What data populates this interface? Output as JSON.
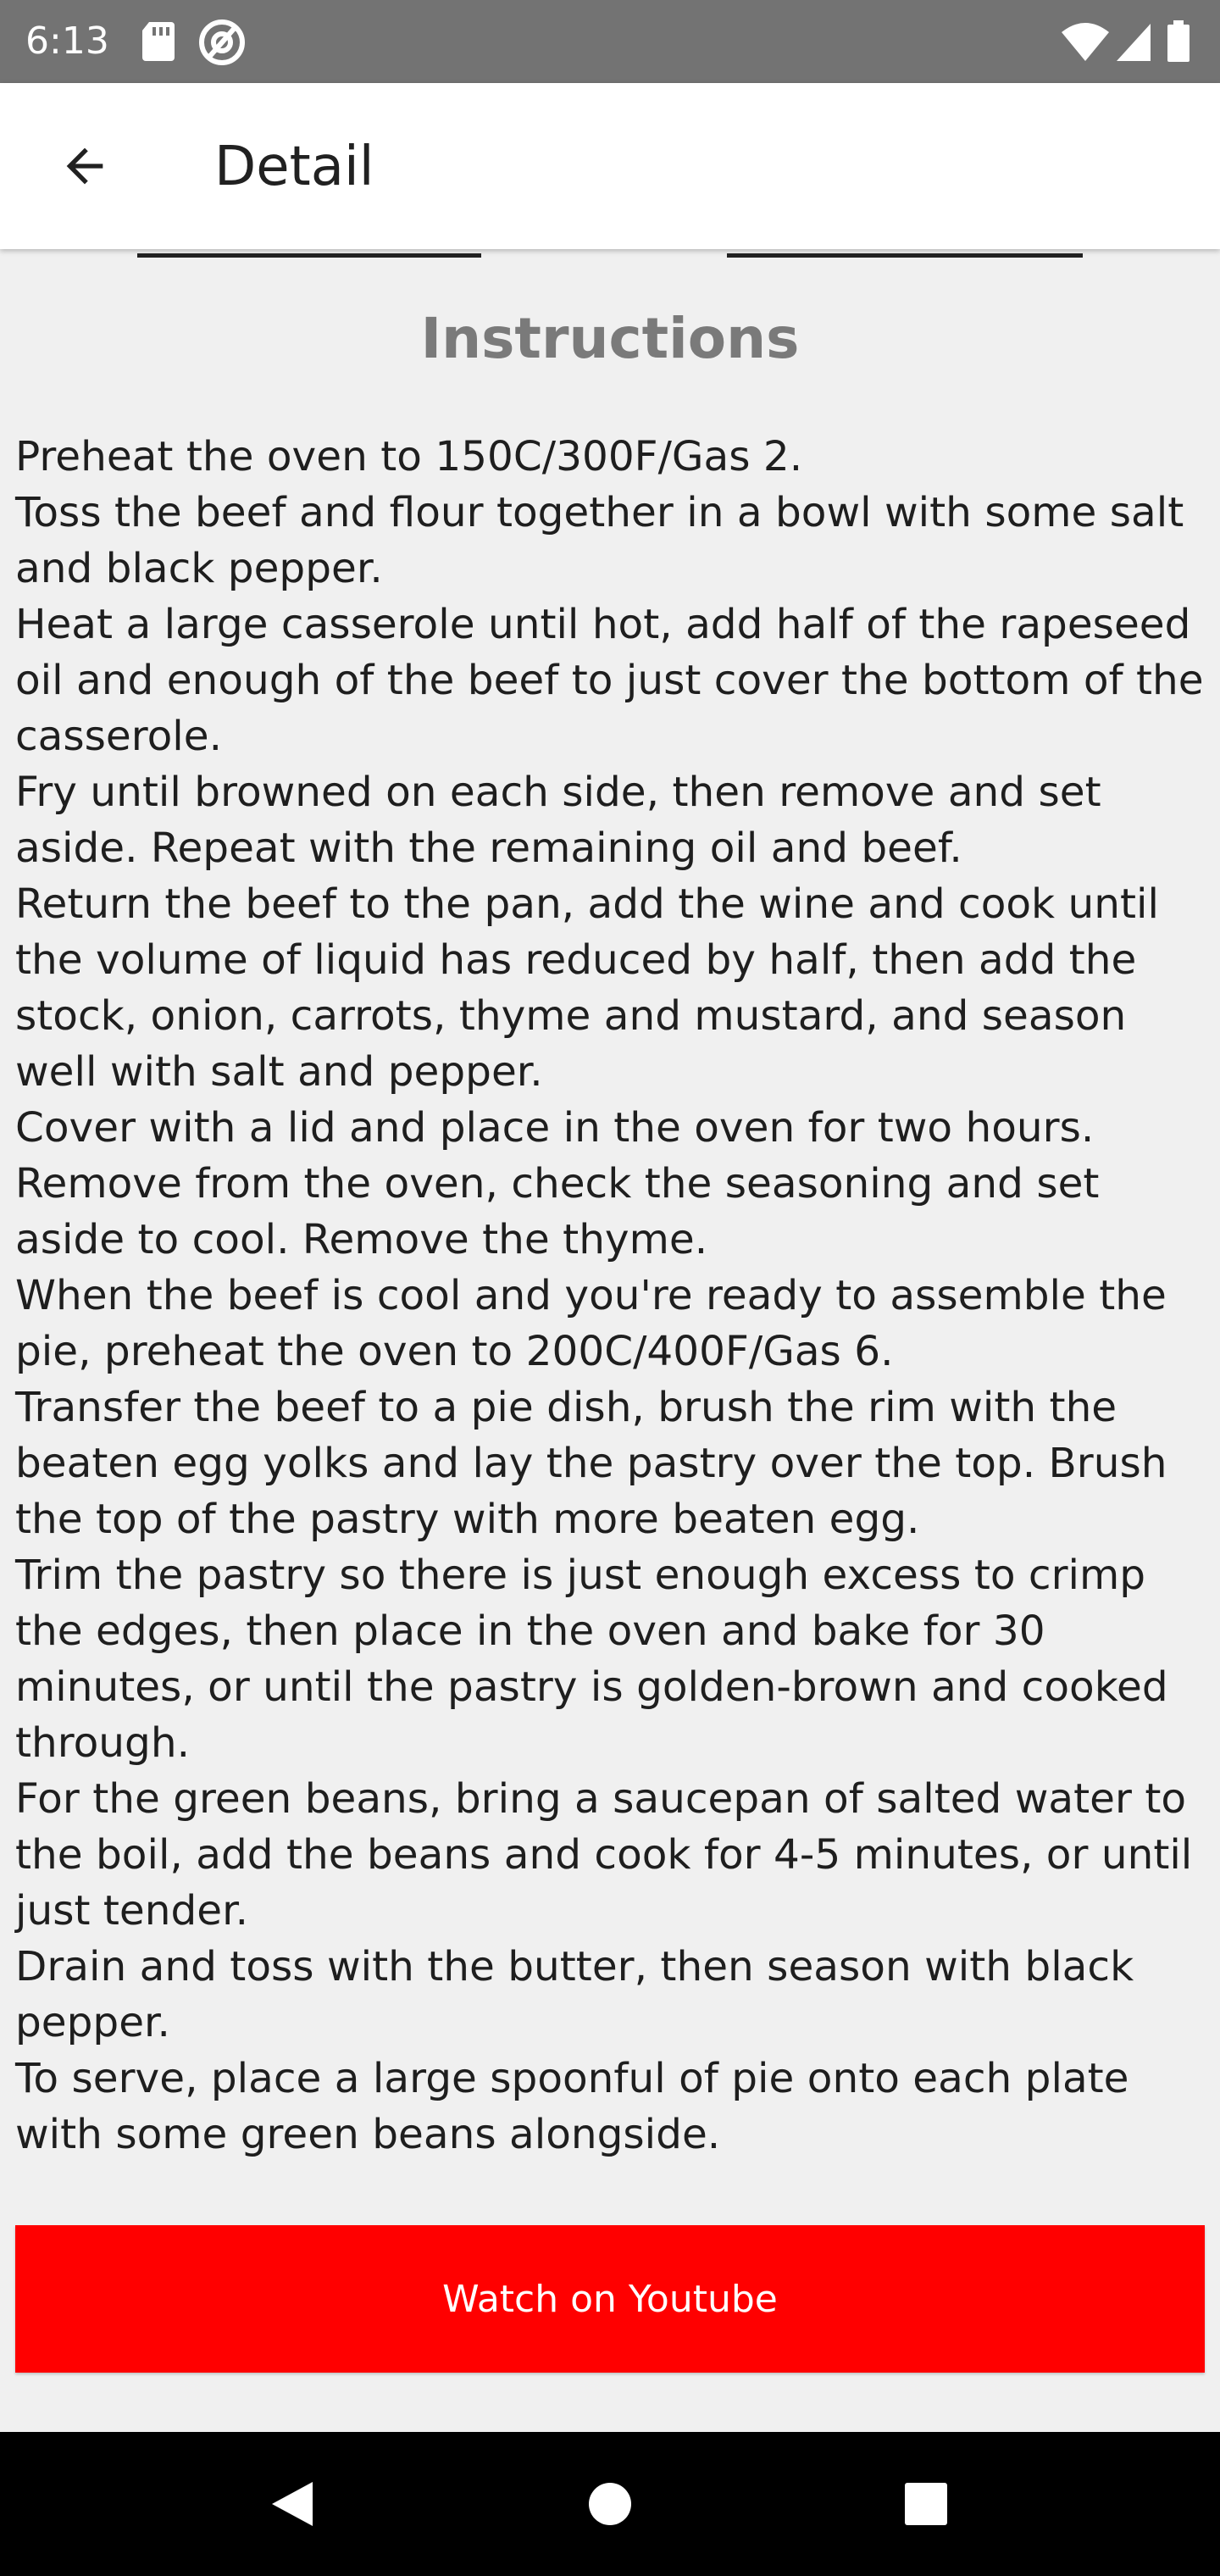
{
  "status_bar": {
    "time": "6:13",
    "icons": [
      "sd-card-icon",
      "at-sign-icon",
      "wifi-icon",
      "signal-icon",
      "battery-icon"
    ]
  },
  "app_bar": {
    "title": "Detail",
    "back_icon": "arrow-left-icon"
  },
  "instructions": {
    "title": "Instructions",
    "text": "Preheat the oven to 150C/300F/Gas 2.\nToss the beef and flour together in a bowl with some salt and black pepper.\nHeat a large casserole until hot, add half of the rapeseed oil and enough of the beef to just cover the bottom of the casserole.\nFry until browned on each side, then remove and set aside. Repeat with the remaining oil and beef.\nReturn the beef to the pan, add the wine and cook until the volume of liquid has reduced by half, then add the stock, onion, carrots, thyme and mustard, and season well with salt and pepper.\nCover with a lid and place in the oven for two hours.\nRemove from the oven, check the seasoning and set aside to cool. Remove the thyme.\nWhen the beef is cool and you're ready to assemble the pie, preheat the oven to 200C/400F/Gas 6.\nTransfer the beef to a pie dish, brush the rim with the beaten egg yolks and lay the pastry over the top. Brush the top of the pastry with more beaten egg.\nTrim the pastry so there is just enough excess to crimp the edges, then place in the oven and bake for 30 minutes, or until the pastry is golden-brown and cooked through.\nFor the green beans, bring a saucepan of salted water to the boil, add the beans and cook for 4-5 minutes, or until just tender.\nDrain and toss with the butter, then season with black pepper.\nTo serve, place a large spoonful of pie onto each plate with some green beans alongside."
  },
  "actions": {
    "youtube_label": "Watch on Youtube"
  },
  "colors": {
    "status_bar": "#737373",
    "app_bar": "#ffffff",
    "background": "#f0f0f0",
    "section_title": "#7a7a7a",
    "youtube_button": "#ff0000",
    "nav_bar": "#000000"
  },
  "nav_bar": {
    "icons": [
      "nav-back-icon",
      "nav-home-icon",
      "nav-recents-icon"
    ]
  }
}
